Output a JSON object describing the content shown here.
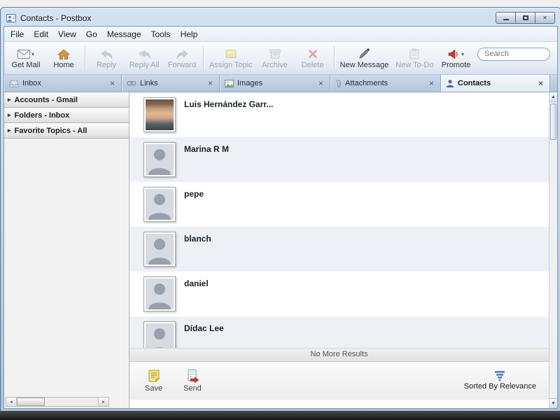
{
  "window": {
    "title": "Contacts - Postbox",
    "controls": {
      "minimize": "minimize",
      "maximize": "maximize",
      "close": "close"
    }
  },
  "menubar": {
    "items": [
      "File",
      "Edit",
      "View",
      "Go",
      "Message",
      "Tools",
      "Help"
    ]
  },
  "toolbar": {
    "get_mail": "Get Mail",
    "home": "Home",
    "reply": "Reply",
    "reply_all": "Reply All",
    "forward": "Forward",
    "assign_topic": "Assign Topic",
    "archive": "Archive",
    "delete": "Delete",
    "new_message": "New Message",
    "new_todo": "New To-Do",
    "promote": "Promote",
    "search_placeholder": "Search"
  },
  "tabs": {
    "inbox": "Inbox",
    "links": "Links",
    "images": "Images",
    "attachments": "Attachments",
    "contacts": "Contacts",
    "close_glyph": "×"
  },
  "sidebar": {
    "sections": [
      {
        "label": "Accounts - Gmail"
      },
      {
        "label": "Folders - Inbox"
      },
      {
        "label": "Favorite Topics - All"
      }
    ]
  },
  "contacts": {
    "items": [
      {
        "name": "Luis Hernández Garr..."
      },
      {
        "name": "Marina R M"
      },
      {
        "name": "pepe"
      },
      {
        "name": "blanch"
      },
      {
        "name": "daniel"
      },
      {
        "name": "Dídac Lee"
      }
    ],
    "no_more_results": "No More Results"
  },
  "footer": {
    "save": "Save",
    "send": "Send",
    "sorted": "Sorted By Relevance"
  },
  "colors": {
    "delete_red": "#c63b31",
    "promote_red": "#c63b31",
    "topic_yellow": "#eed45f",
    "home_orange": "#e0953c",
    "sort_blue": "#4a7fc0"
  }
}
